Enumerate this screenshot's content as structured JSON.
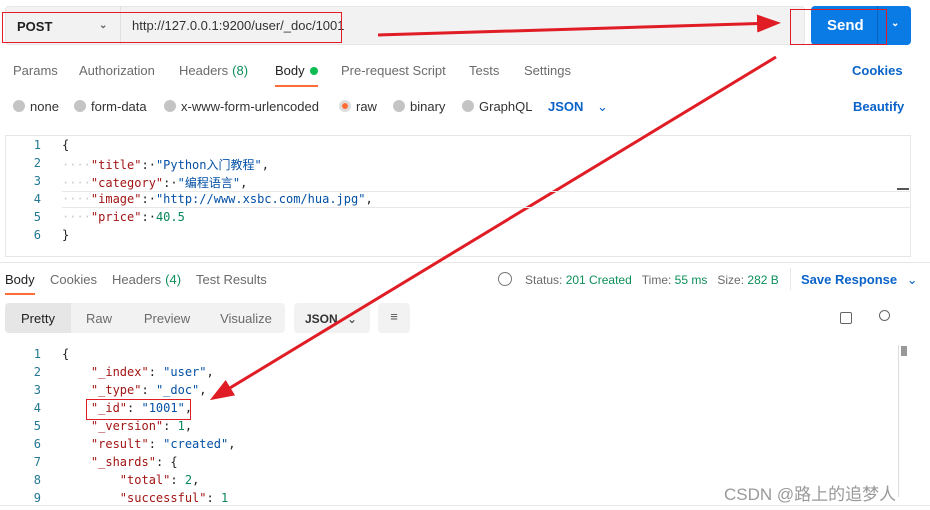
{
  "request": {
    "method": "POST",
    "url": "http://127.0.0.1:9200/user/_doc/1001",
    "send_label": "Send"
  },
  "request_tabs": [
    {
      "label": "Params"
    },
    {
      "label": "Authorization"
    },
    {
      "label": "Headers",
      "count": "(8)"
    },
    {
      "label": "Body",
      "active": true
    },
    {
      "label": "Pre-request Script"
    },
    {
      "label": "Tests"
    },
    {
      "label": "Settings"
    }
  ],
  "cookies_label": "Cookies",
  "body_types": [
    {
      "label": "none"
    },
    {
      "label": "form-data"
    },
    {
      "label": "x-www-form-urlencoded"
    },
    {
      "label": "raw",
      "selected": true
    },
    {
      "label": "binary"
    },
    {
      "label": "GraphQL"
    }
  ],
  "body_format": "JSON",
  "beautify_label": "Beautify",
  "request_body": [
    {
      "n": "1",
      "t": "{"
    },
    {
      "n": "2",
      "key": "\"title\"",
      "val": "\"Python入门教程\"",
      "tail": ","
    },
    {
      "n": "3",
      "key": "\"category\"",
      "val": "\"编程语言\"",
      "tail": ","
    },
    {
      "n": "4",
      "key": "\"image\"",
      "val": "\"http://www.xsbc.com/hua.jpg\"",
      "tail": ","
    },
    {
      "n": "5",
      "key": "\"price\"",
      "num": "40.5"
    },
    {
      "n": "6",
      "t": "}"
    }
  ],
  "response_tabs": [
    {
      "label": "Body",
      "active": true
    },
    {
      "label": "Cookies"
    },
    {
      "label": "Headers",
      "count": "(4)"
    },
    {
      "label": "Test Results"
    }
  ],
  "status": {
    "status_label": "Status:",
    "status": "201 Created",
    "time_label": "Time:",
    "time": "55 ms",
    "size_label": "Size:",
    "size": "282 B"
  },
  "save_response_label": "Save Response",
  "view_modes": [
    "Pretty",
    "Raw",
    "Preview",
    "Visualize"
  ],
  "response_format": "JSON",
  "response_body": [
    {
      "n": "1",
      "t": "{"
    },
    {
      "n": "2",
      "key": "\"_index\"",
      "val": "\"user\"",
      "tail": ","
    },
    {
      "n": "3",
      "key": "\"_type\"",
      "val": "\"_doc\"",
      "tail": ","
    },
    {
      "n": "4",
      "key": "\"_id\"",
      "val": "\"1001\"",
      "tail": ","
    },
    {
      "n": "5",
      "key": "\"_version\"",
      "num": "1",
      "tail": ","
    },
    {
      "n": "6",
      "key": "\"result\"",
      "val": "\"created\"",
      "tail": ","
    },
    {
      "n": "7",
      "key": "\"_shards\"",
      "t2": "{"
    },
    {
      "n": "8",
      "key": "\"total\"",
      "num": "2",
      "tail": ",",
      "indent": 2
    },
    {
      "n": "9",
      "key": "\"successful\"",
      "num": "1",
      "indent": 2
    }
  ],
  "watermark": "CSDN @路上的追梦人",
  "colors": {
    "accent": "#0a7ae5",
    "active_tab": "#ff6c37",
    "annotation": "#e01c24",
    "status_green": "#0c8e5a"
  }
}
